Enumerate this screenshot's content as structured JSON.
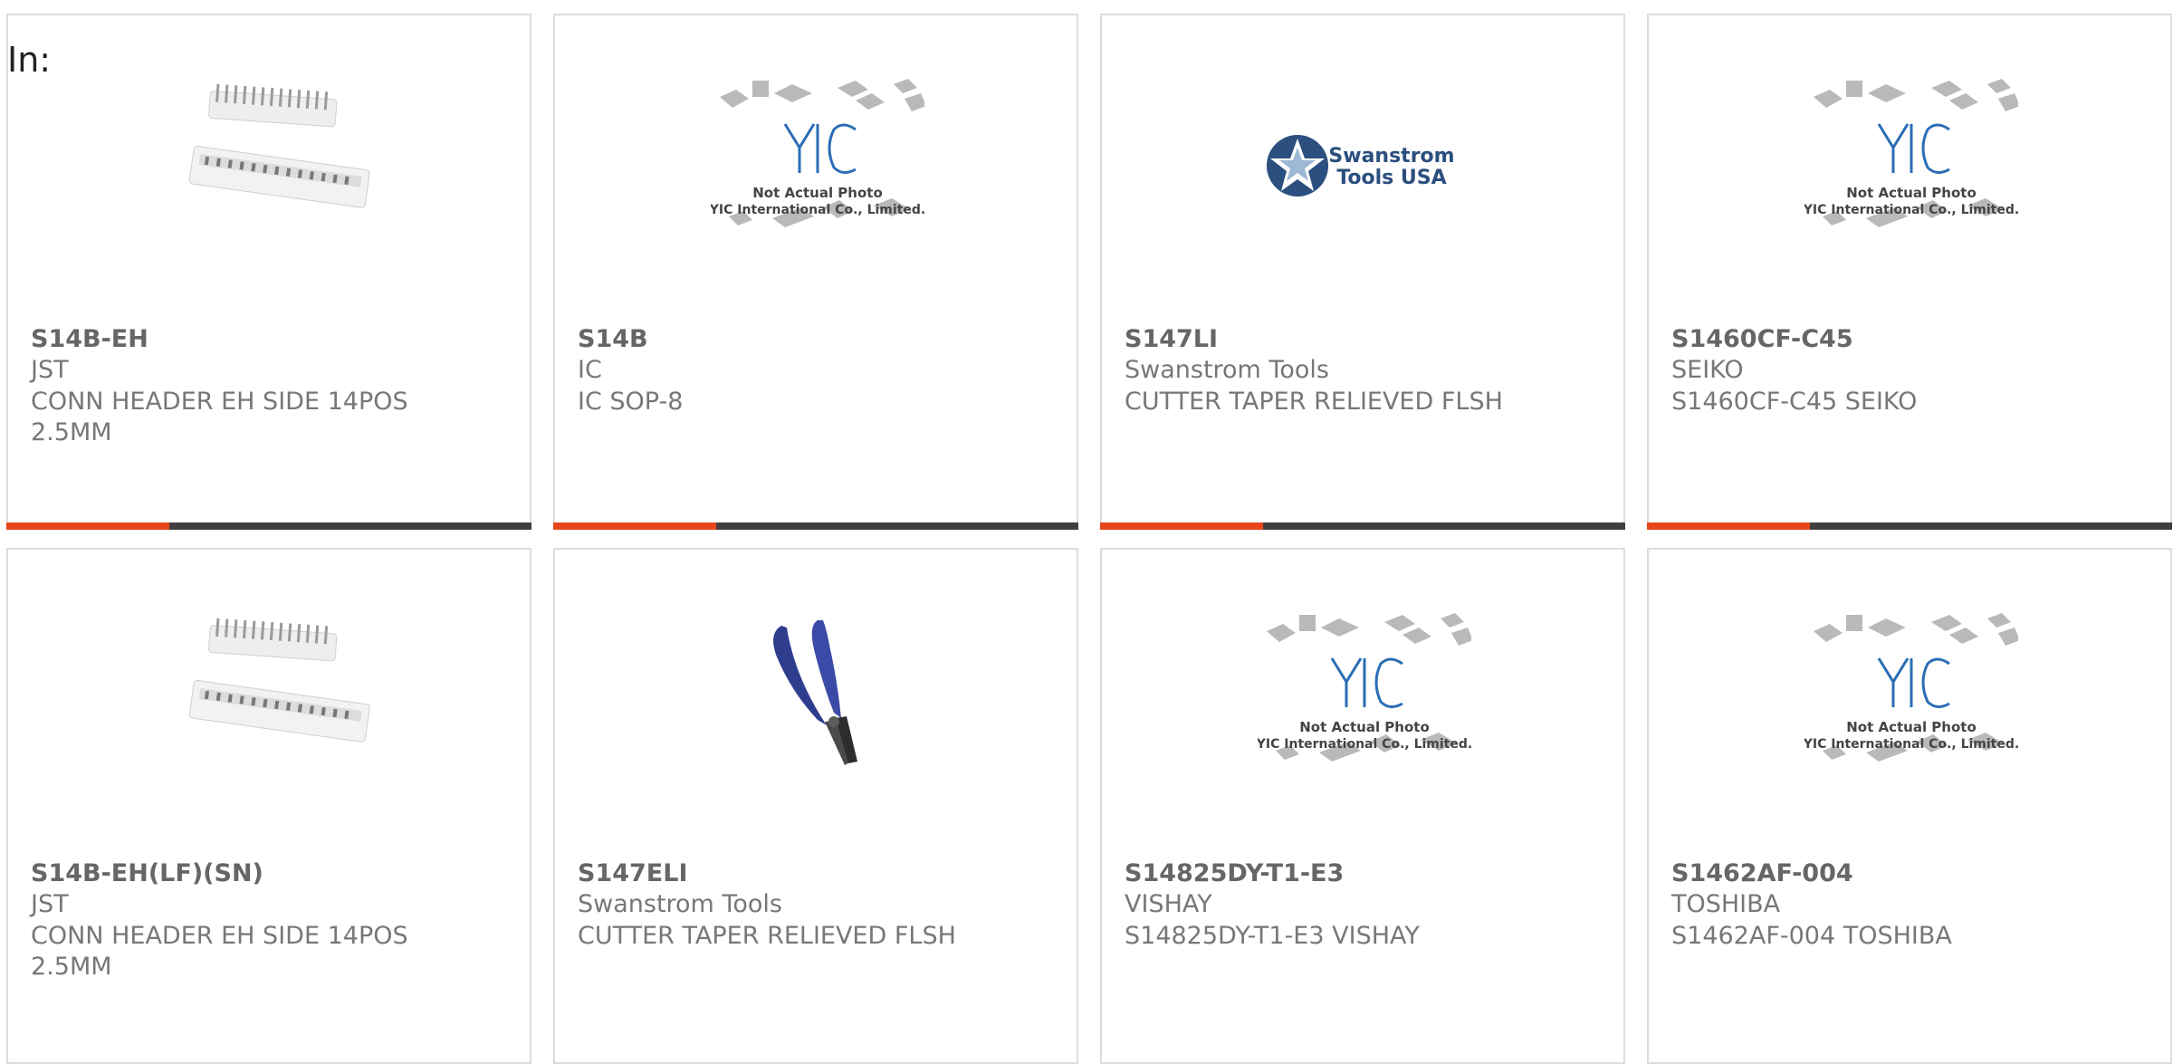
{
  "in_label": "In:",
  "colors": {
    "accent": "#e8461a",
    "bar": "#3f3f3f",
    "border": "#dcdcdc",
    "yic_blue": "#2a6db5"
  },
  "placeholder": {
    "line1": "Not Actual Photo",
    "line2": "YIC International Co., Limited.",
    "logo": "YIC"
  },
  "swanstrom_logo": {
    "line1": "Swanstrom",
    "line2": "Tools USA"
  },
  "products": [
    {
      "part": "S14B-EH",
      "mfr": "JST",
      "desc": "CONN HEADER EH SIDE 14POS 2.5MM",
      "image": "connector-icon",
      "accent_fraction": 0.31
    },
    {
      "part": "S14B",
      "mfr": "IC",
      "desc": "IC SOP-8",
      "image": "yic-placeholder",
      "accent_fraction": 0.31
    },
    {
      "part": "S147LI",
      "mfr": "Swanstrom Tools",
      "desc": "CUTTER TAPER RELIEVED FLSH",
      "image": "swanstrom-logo",
      "accent_fraction": 0.31
    },
    {
      "part": "S1460CF-C45",
      "mfr": "SEIKO",
      "desc": "S1460CF-C45 SEIKO",
      "image": "yic-placeholder",
      "accent_fraction": 0.31
    },
    {
      "part": "S14B-EH(LF)(SN)",
      "mfr": "JST",
      "desc": "CONN HEADER EH SIDE 14POS 2.5MM",
      "image": "connector-icon"
    },
    {
      "part": "S147ELI",
      "mfr": "Swanstrom Tools",
      "desc": "CUTTER TAPER RELIEVED FLSH",
      "image": "cutter-icon"
    },
    {
      "part": "S14825DY-T1-E3",
      "mfr": "VISHAY",
      "desc": "S14825DY-T1-E3 VISHAY",
      "image": "yic-placeholder"
    },
    {
      "part": "S1462AF-004",
      "mfr": "TOSHIBA",
      "desc": "S1462AF-004 TOSHIBA",
      "image": "yic-placeholder"
    }
  ]
}
